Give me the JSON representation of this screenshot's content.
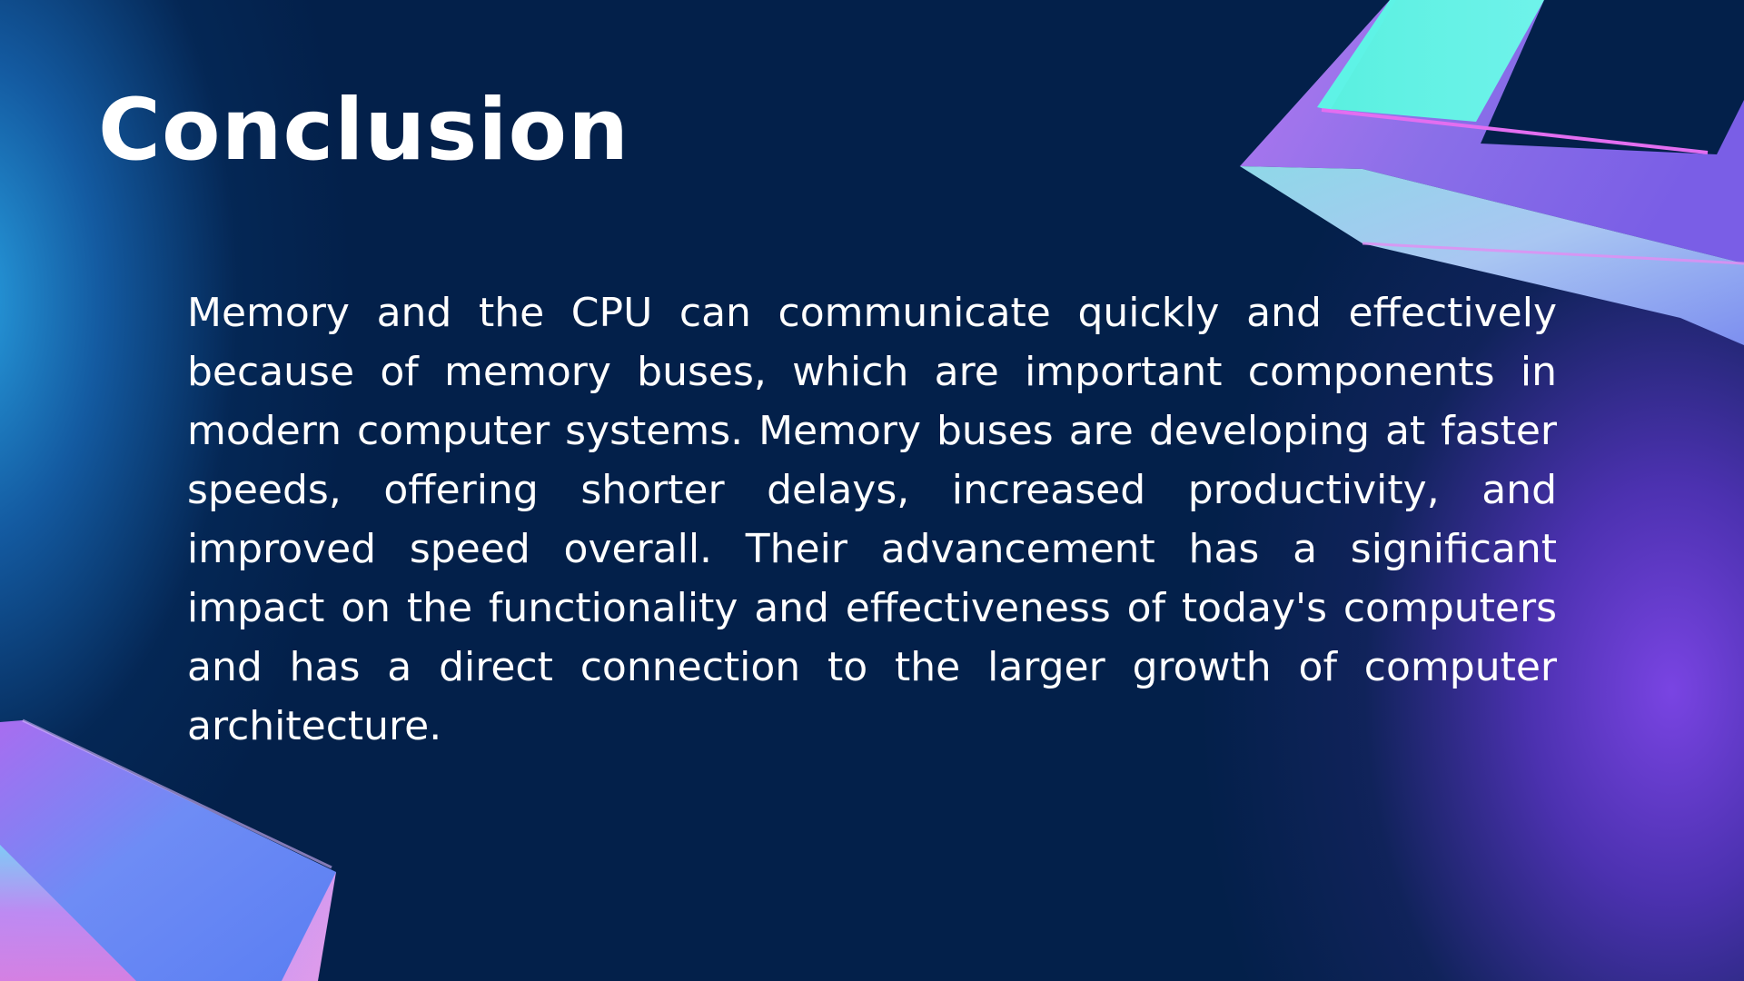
{
  "slide": {
    "title": "Conclusion",
    "body": "Memory and the CPU can communicate quickly and effectively because of memory buses, which are important components in modern computer systems. Memory buses are developing at faster speeds, offering shorter delays, increased productivity, and improved speed overall. Their advancement has a significant impact on the functionality and effectiveness of today's computers and has a direct connection to the larger growth of computer architecture."
  },
  "colors": {
    "background": "#03204a",
    "text": "#ffffff",
    "accent_purple": "#7b4fe6",
    "accent_blue": "#2a9ee0",
    "accent_cyan": "#5ef3e6"
  },
  "decorations": [
    "frame-shape-top-right",
    "cube-shape-bottom-left"
  ]
}
